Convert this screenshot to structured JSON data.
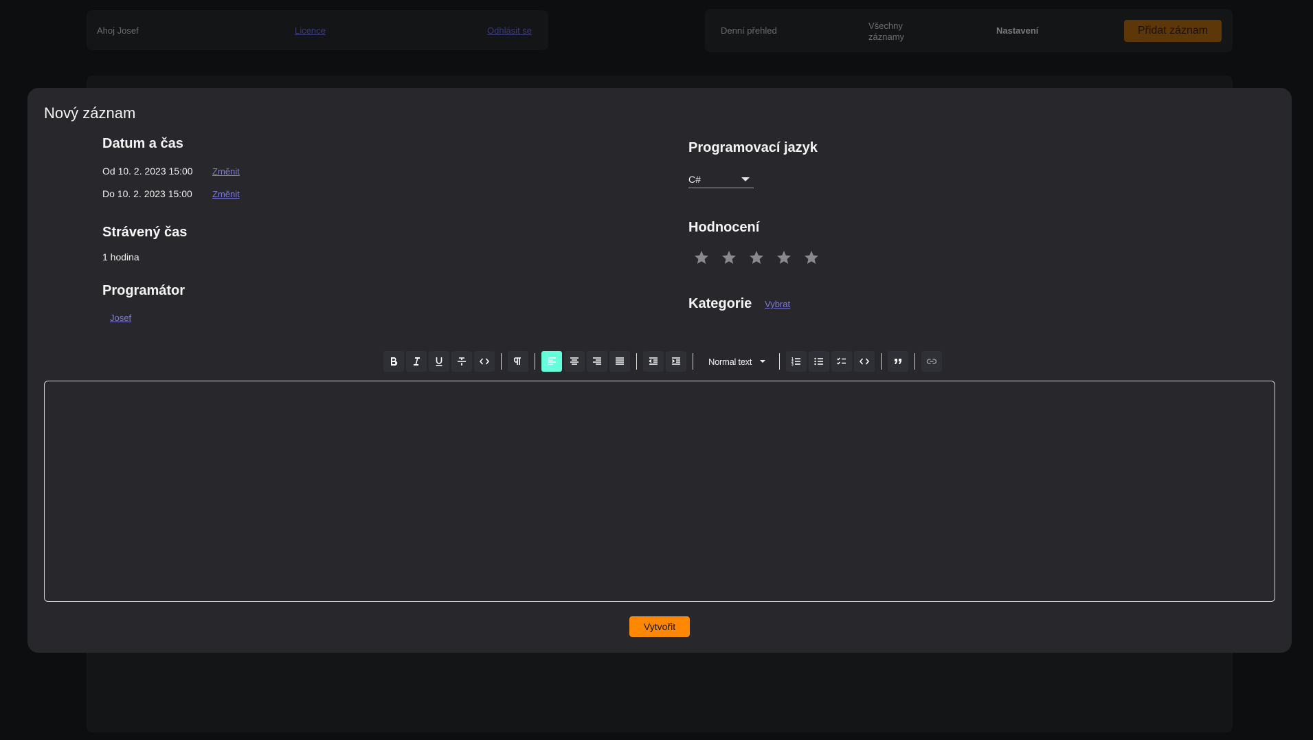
{
  "background": {
    "nav_left": {
      "greeting": "Ahoj Josef",
      "license": "Licence",
      "logout": "Odhlásit se"
    },
    "nav_right": {
      "daily": "Denní přehled",
      "all_records_line1": "Všechny",
      "all_records_line2": "záznamy",
      "settings": "Nastavení",
      "add_record": "Přidat záznam"
    }
  },
  "modal": {
    "title": "Nový záznam",
    "datetime": {
      "title": "Datum a čas",
      "from": "Od 10. 2. 2023 15:00",
      "to": "Do 10. 2. 2023 15:00",
      "change_label": "Změnit"
    },
    "time_spent": {
      "title": "Strávený čas",
      "value": "1 hodina"
    },
    "programmer": {
      "title": "Programátor",
      "name": "Josef"
    },
    "language": {
      "title": "Programovací jazyk",
      "selected": "C#"
    },
    "rating": {
      "title": "Hodnocení",
      "value": 0,
      "max": 5,
      "star_color": "#8a8a8e"
    },
    "category": {
      "title": "Kategorie",
      "choose": "Vybrat"
    },
    "toolbar": {
      "block_type": "Normal text",
      "active_color": "#64ffda",
      "buttons": [
        "bold-icon",
        "italic-icon",
        "underline-icon",
        "strikethrough-icon",
        "code-icon",
        "paragraph-icon",
        "align-left-icon",
        "align-center-icon",
        "align-right-icon",
        "align-justify-icon",
        "outdent-icon",
        "indent-icon",
        "ordered-list-icon",
        "bullet-list-icon",
        "checklist-icon",
        "code-block-icon",
        "quote-icon",
        "link-icon"
      ]
    },
    "editor": {
      "content": ""
    },
    "create_button": "Vytvořit"
  },
  "colors": {
    "accent": "#ff8800",
    "link": "#7d7ccf",
    "modal_bg": "#28282c",
    "page_bg": "#0d0e10"
  }
}
